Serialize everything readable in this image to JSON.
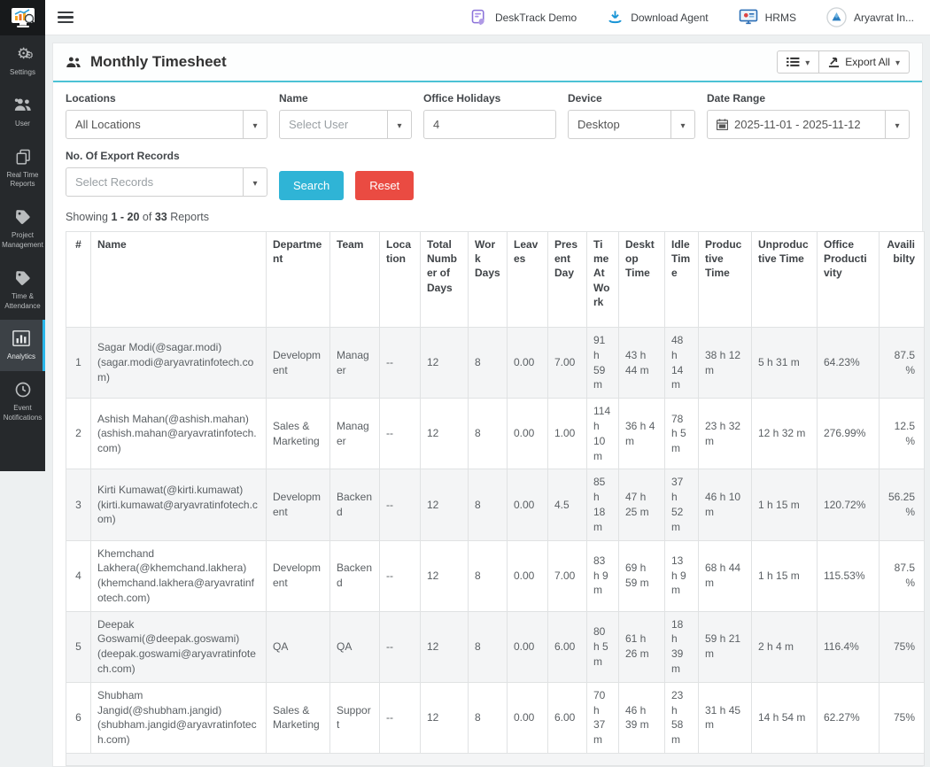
{
  "colors": {
    "accent": "#4cc2d5",
    "search_button": "#2fb4d6",
    "reset_button": "#ea4b42",
    "sidebar_active_border": "#29b6ea"
  },
  "navbar": {
    "menu_items": [
      {
        "label": "DeskTrack Demo",
        "icon": "desktrack-demo-icon"
      },
      {
        "label": "Download Agent",
        "icon": "download-icon"
      },
      {
        "label": "HRMS",
        "icon": "monitor-icon"
      },
      {
        "label": "Aryavrat In...",
        "icon": "avatar"
      }
    ]
  },
  "sidebar": {
    "items": [
      {
        "label": "Settings",
        "icon": "gears-icon",
        "active": false
      },
      {
        "label": "User",
        "icon": "users-icon",
        "active": false
      },
      {
        "label": "Real Time Reports",
        "icon": "pages-icon",
        "active": false
      },
      {
        "label": "Project Management",
        "icon": "tag-icon",
        "active": false
      },
      {
        "label": "Time & Attendance",
        "icon": "tag-icon",
        "active": false
      },
      {
        "label": "Analytics",
        "icon": "bar-chart-icon",
        "active": true
      },
      {
        "label": "Event Notifications",
        "icon": "clock-icon",
        "active": false
      }
    ]
  },
  "page": {
    "title": "Monthly Timesheet",
    "export_all_label": "Export All"
  },
  "filters": {
    "locations": {
      "label": "Locations",
      "value": "All Locations"
    },
    "name": {
      "label": "Name",
      "placeholder": "Select User"
    },
    "office_holidays": {
      "label": "Office Holidays",
      "value": "4"
    },
    "device": {
      "label": "Device",
      "value": "Desktop"
    },
    "date_range": {
      "label": "Date Range",
      "value": "2025-11-01 - 2025-11-12"
    },
    "export_records": {
      "label": "No. Of Export Records",
      "placeholder": "Select Records"
    },
    "search_label": "Search",
    "reset_label": "Reset"
  },
  "summary": {
    "showing": "Showing",
    "range": "1 - 20",
    "of": "of",
    "total": "33",
    "reports": "Reports"
  },
  "table": {
    "columns": [
      "#",
      "Name",
      "Department",
      "Team",
      "Location",
      "Total Number of Days",
      "Work Days",
      "Leaves",
      "Present Day",
      "Time At Work",
      "Desktop Time",
      "Idle Time",
      "Productive Time",
      "Unproductive Time",
      "Office Productivity",
      "Availibilty"
    ],
    "rows": [
      {
        "num": "1",
        "name": "Sagar Modi(@sagar.modi)",
        "email": "(sagar.modi@aryavratinfotech.com)",
        "department": "Development",
        "team": "Manager",
        "location": "--",
        "total_days": "12",
        "work_days": "8",
        "leaves": "0.00",
        "present_day": "7.00",
        "time_at_work": "91 h 59 m",
        "desktop_time": "43 h 44 m",
        "idle_time": "48 h 14 m",
        "productive_time": "38 h 12 m",
        "unproductive_time": "5 h 31 m",
        "office_productivity": "64.23%",
        "availability": "87.5%"
      },
      {
        "num": "2",
        "name": "Ashish Mahan(@ashish.mahan)",
        "email": "(ashish.mahan@aryavratinfotech.com)",
        "department": "Sales & Marketing",
        "team": "Manager",
        "location": "--",
        "total_days": "12",
        "work_days": "8",
        "leaves": "0.00",
        "present_day": "1.00",
        "time_at_work": "114 h 10 m",
        "desktop_time": "36 h 4 m",
        "idle_time": "78 h 5 m",
        "productive_time": "23 h 32 m",
        "unproductive_time": "12 h 32 m",
        "office_productivity": "276.99%",
        "availability": "12.5%"
      },
      {
        "num": "3",
        "name": "Kirti Kumawat(@kirti.kumawat)",
        "email": "(kirti.kumawat@aryavratinfotech.com)",
        "department": "Development",
        "team": "Backend",
        "location": "--",
        "total_days": "12",
        "work_days": "8",
        "leaves": "0.00",
        "present_day": "4.5",
        "time_at_work": "85 h 18 m",
        "desktop_time": "47 h 25 m",
        "idle_time": "37 h 52 m",
        "productive_time": "46 h 10 m",
        "unproductive_time": "1 h 15 m",
        "office_productivity": "120.72%",
        "availability": "56.25%"
      },
      {
        "num": "4",
        "name": "Khemchand Lakhera(@khemchand.lakhera)",
        "email": "(khemchand.lakhera@aryavratinfotech.com)",
        "department": "Development",
        "team": "Backend",
        "location": "--",
        "total_days": "12",
        "work_days": "8",
        "leaves": "0.00",
        "present_day": "7.00",
        "time_at_work": "83 h 9 m",
        "desktop_time": "69 h 59 m",
        "idle_time": "13 h 9 m",
        "productive_time": "68 h 44 m",
        "unproductive_time": "1 h 15 m",
        "office_productivity": "115.53%",
        "availability": "87.5%"
      },
      {
        "num": "5",
        "name": "Deepak Goswami(@deepak.goswami)",
        "email": "(deepak.goswami@aryavratinfotech.com)",
        "department": "QA",
        "team": "QA",
        "location": "--",
        "total_days": "12",
        "work_days": "8",
        "leaves": "0.00",
        "present_day": "6.00",
        "time_at_work": "80 h 5 m",
        "desktop_time": "61 h 26 m",
        "idle_time": "18 h 39 m",
        "productive_time": "59 h 21 m",
        "unproductive_time": "2 h 4 m",
        "office_productivity": "116.4%",
        "availability": "75%"
      },
      {
        "num": "6",
        "name": "Shubham Jangid(@shubham.jangid)",
        "email": "(shubham.jangid@aryavratinfotech.com)",
        "department": "Sales & Marketing",
        "team": "Support",
        "location": "--",
        "total_days": "12",
        "work_days": "8",
        "leaves": "0.00",
        "present_day": "6.00",
        "time_at_work": "70 h 37 m",
        "desktop_time": "46 h 39 m",
        "idle_time": "23 h 58 m",
        "productive_time": "31 h 45 m",
        "unproductive_time": "14 h 54 m",
        "office_productivity": "62.27%",
        "availability": "75%"
      }
    ]
  }
}
